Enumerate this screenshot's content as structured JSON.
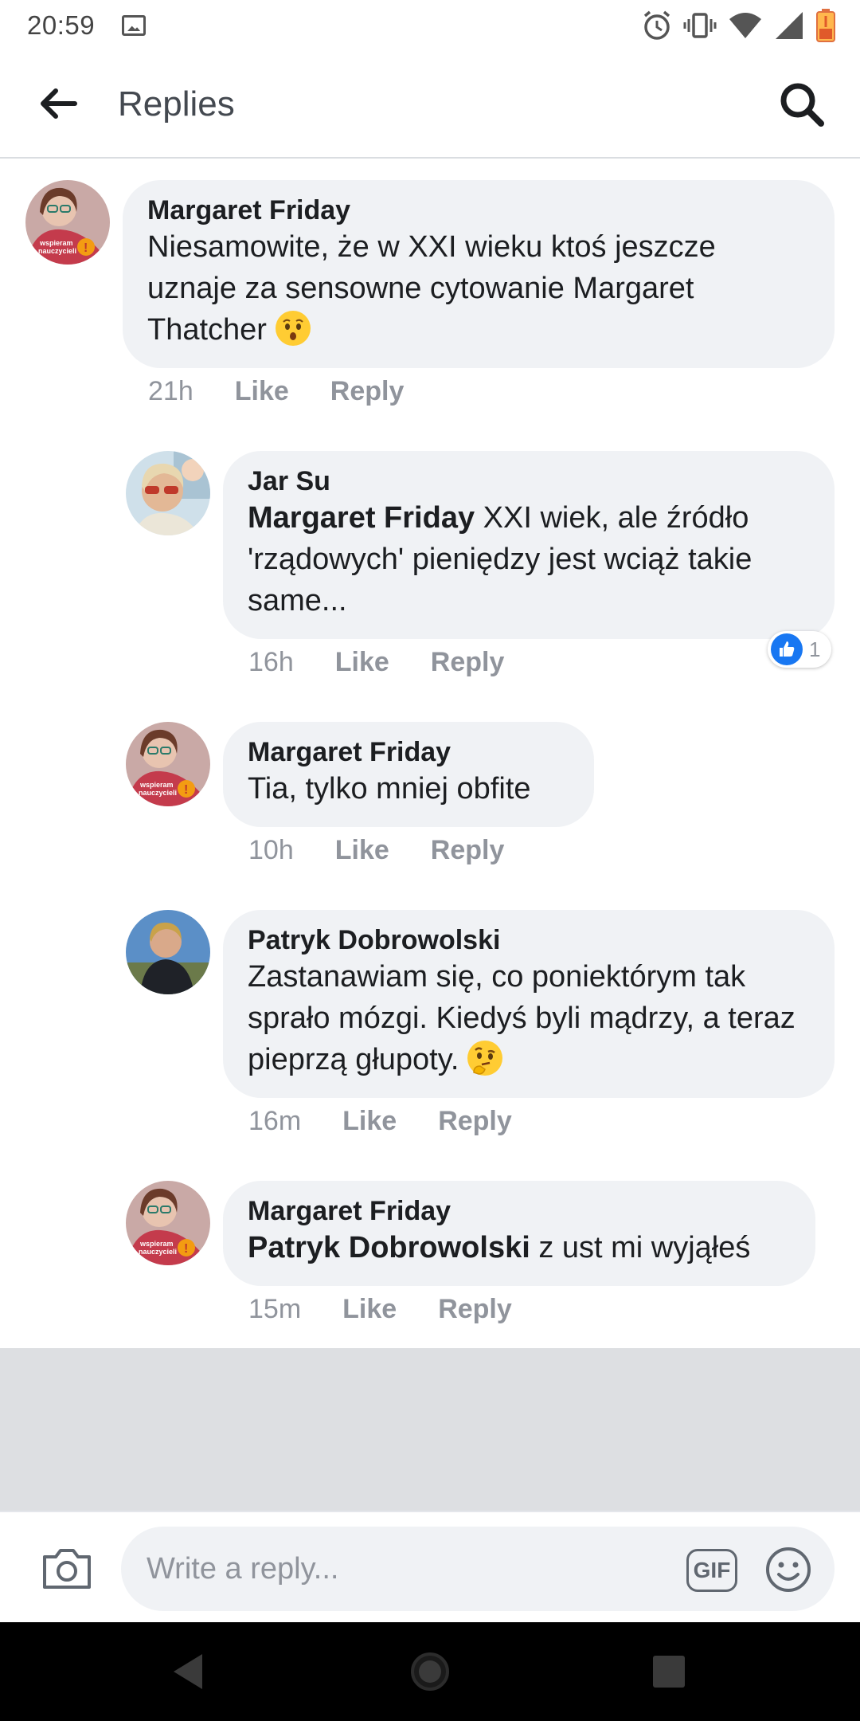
{
  "status_bar": {
    "time": "20:59"
  },
  "header": {
    "title": "Replies"
  },
  "comments": [
    {
      "author": "Margaret Friday",
      "tag": "",
      "text": "Niesamowite, że w XXI wieku ktoś jeszcze uznaje za sensowne cytowanie Margaret Thatcher",
      "emoji": "hushed-face-emoji",
      "time": "21h",
      "like_label": "Like",
      "reply_label": "Reply"
    },
    {
      "author": "Jar Su",
      "tag": "Margaret Friday",
      "text": " XXI wiek, ale źródło 'rządowych' pieniędzy jest wciąż takie same...",
      "time": "16h",
      "like_label": "Like",
      "reply_label": "Reply",
      "reaction_count": "1"
    },
    {
      "author": "Margaret Friday",
      "tag": "",
      "text": "Tia, tylko mniej obfite",
      "time": "10h",
      "like_label": "Like",
      "reply_label": "Reply"
    },
    {
      "author": "Patryk Dobrowolski",
      "tag": "",
      "text": "Zastanawiam się, co poniektórym tak sprało mózgi. Kiedyś byli mądrzy, a teraz pieprzą głupoty.",
      "emoji": "thinking-face-emoji",
      "time": "16m",
      "like_label": "Like",
      "reply_label": "Reply"
    },
    {
      "author": "Margaret Friday",
      "tag": "Patryk Dobrowolski",
      "text": " z ust mi wyjąłeś",
      "time": "15m",
      "like_label": "Like",
      "reply_label": "Reply"
    }
  ],
  "composer": {
    "placeholder": "Write a reply...",
    "gif_label": "GIF"
  },
  "colors": {
    "bubble": "#f0f2f5",
    "like_blue": "#1877f2",
    "meta_grey": "#90949c"
  }
}
